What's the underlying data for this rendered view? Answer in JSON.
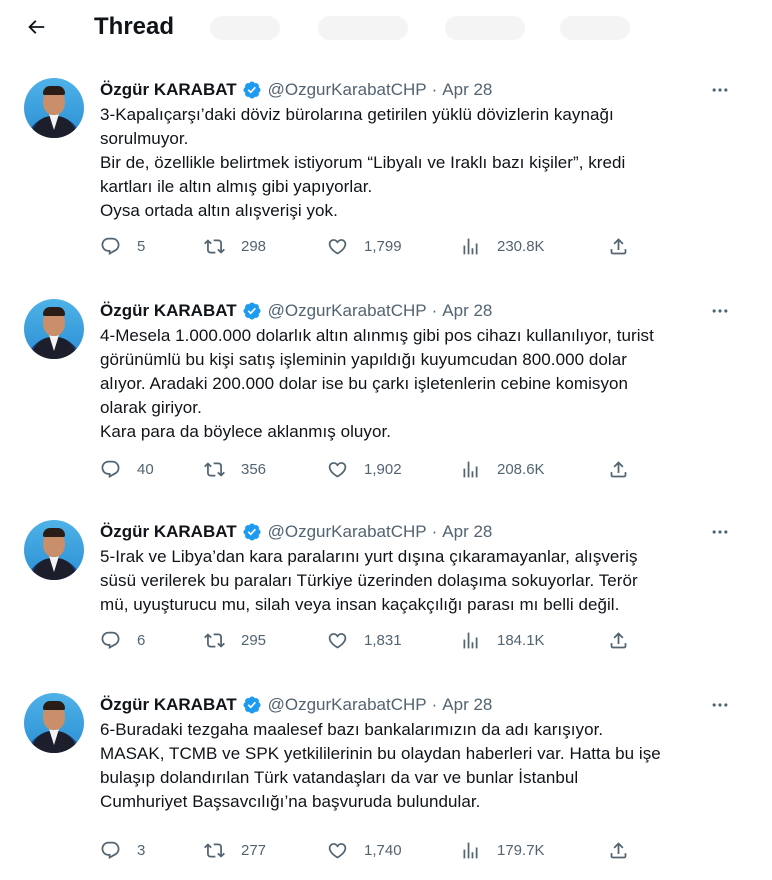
{
  "header": {
    "title": "Thread"
  },
  "tweets": [
    {
      "name": "Özgür KARABAT",
      "handle": "@OzgurKarabatCHP",
      "dot": "·",
      "date": "Apr 28",
      "text": "3-Kapalıçarşı’daki döviz bürolarına getirilen yüklü dövizlerin kaynağı\nsorulmuyor.\nBir de, özellikle belirtmek istiyorum “Libyalı ve Iraklı bazı kişiler”, kredi\nkartları ile altın almış gibi yapıyorlar.\nOysa ortada altın alışverişi yok.",
      "replies": "5",
      "retweets": "298",
      "likes": "1,799",
      "views": "230.8K"
    },
    {
      "name": "Özgür KARABAT",
      "handle": "@OzgurKarabatCHP",
      "dot": "·",
      "date": "Apr 28",
      "text": "4-Mesela 1.000.000 dolarlık altın alınmış gibi pos cihazı kullanılıyor, turist\ngörünümlü bu kişi satış işleminin yapıldığı kuyumcudan 800.000 dolar\nalıyor. Aradaki 200.000 dolar ise bu çarkı işletenlerin cebine komisyon\nolarak giriyor.\nKara para da böylece aklanmış oluyor.",
      "replies": "40",
      "retweets": "356",
      "likes": "1,902",
      "views": "208.6K"
    },
    {
      "name": "Özgür KARABAT",
      "handle": "@OzgurKarabatCHP",
      "dot": "·",
      "date": "Apr 28",
      "text": "5-Irak ve Libya’dan kara paralarını yurt dışına çıkaramayanlar, alışveriş\nsüsü verilerek bu paraları Türkiye üzerinden dolaşıma sokuyorlar. Terör\nmü, uyuşturucu mu, silah veya insan kaçakçılığı parası mı belli değil.",
      "replies": "6",
      "retweets": "295",
      "likes": "1,831",
      "views": "184.1K"
    },
    {
      "name": "Özgür KARABAT",
      "handle": "@OzgurKarabatCHP",
      "dot": "·",
      "date": "Apr 28",
      "text": "6-Buradaki tezgaha maalesef bazı bankalarımızın da adı karışıyor.\nMASAK, TCMB ve SPK yetkililerinin bu olaydan haberleri var. Hatta bu işe\nbulaşıp dolandırılan Türk vatandaşları da var ve bunlar İstanbul\nCumhuriyet Başsavcılığı’na başvuruda bulundular.",
      "replies": "3",
      "retweets": "277",
      "likes": "1,740",
      "views": "179.7K"
    }
  ],
  "icons": {
    "back": "arrow-left-icon",
    "verified": "verified-badge-icon",
    "more": "more-horizontal-icon",
    "reply": "reply-icon",
    "retweet": "retweet-icon",
    "like": "heart-icon",
    "views": "views-chart-icon",
    "share": "share-icon"
  },
  "colors": {
    "text": "#0f1419",
    "secondary": "#536471",
    "verified": "#1d9bf0",
    "background": "#ffffff"
  }
}
